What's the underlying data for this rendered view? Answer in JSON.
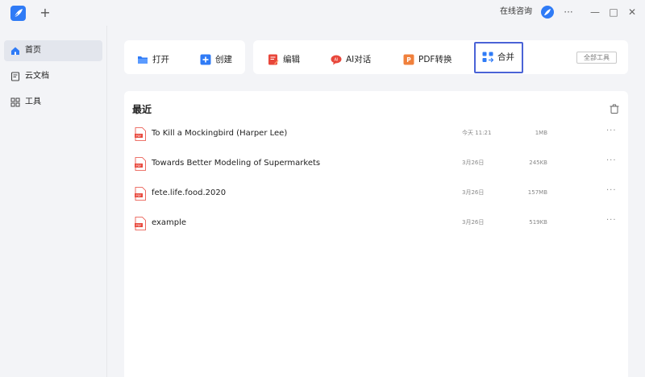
{
  "titlebar": {
    "new_tab": "+",
    "consult": "在线咨询",
    "more": "···",
    "minimize": "—",
    "maximize": "□",
    "close": "✕"
  },
  "sidebar": {
    "items": [
      {
        "label": "首页",
        "icon": "home-icon",
        "active": true
      },
      {
        "label": "云文档",
        "icon": "cloud-doc-icon",
        "active": false
      },
      {
        "label": "工具",
        "icon": "tools-grid-icon",
        "active": false
      }
    ]
  },
  "toolbar": {
    "open": "打开",
    "create": "创建",
    "edit": "编辑",
    "ai_chat": "AI对话",
    "pdf_convert": "PDF转换",
    "merge": "合并",
    "all_tools": "全部工具"
  },
  "recent": {
    "title": "最近",
    "files": [
      {
        "name": "To Kill a Mockingbird (Harper Lee)",
        "date": "今天 11:21",
        "size": "1MB"
      },
      {
        "name": "Towards Better Modeling of Supermarkets",
        "date": "3月26日",
        "size": "245KB"
      },
      {
        "name": "fete.life.food.2020",
        "date": "3月26日",
        "size": "157MB"
      },
      {
        "name": "example",
        "date": "3月26日",
        "size": "519KB"
      }
    ],
    "more": "···"
  },
  "colors": {
    "accent": "#2f7bf6",
    "pdf_red": "#e8473b",
    "merge_border": "#4a63d6",
    "background": "#f3f4f7"
  }
}
